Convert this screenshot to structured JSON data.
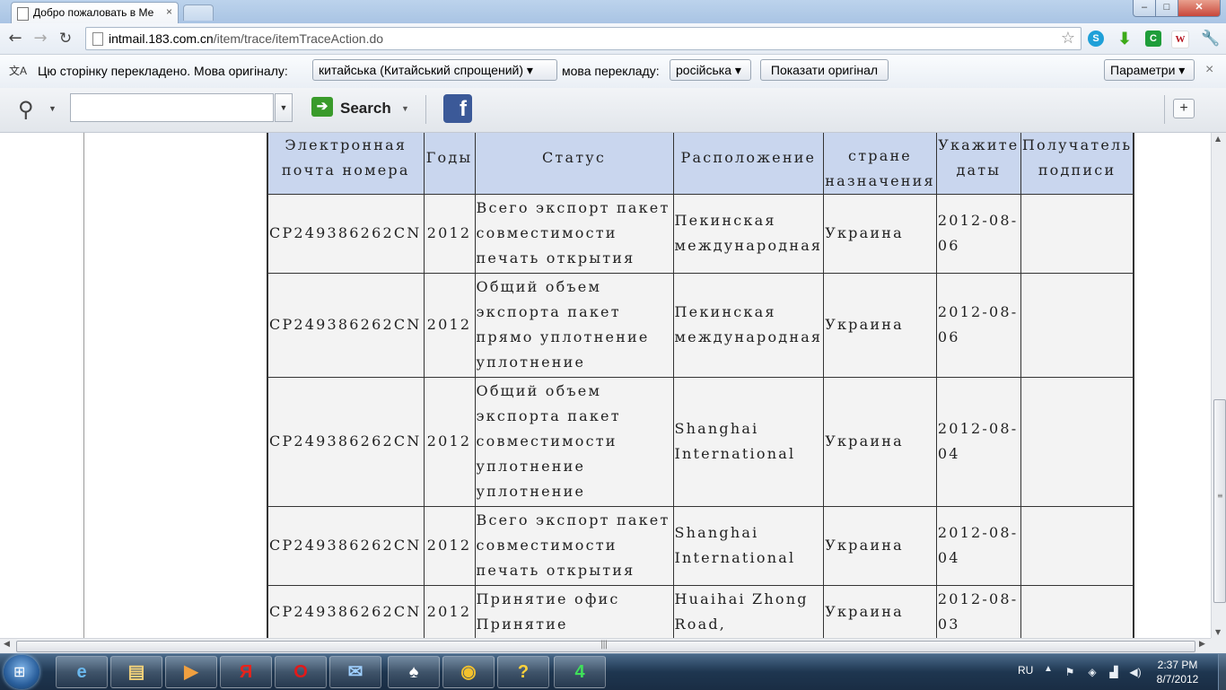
{
  "browser": {
    "tab_title": "Добро пожаловать в Ме",
    "tab_close": "×",
    "url_host": "intmail.183.com.cn",
    "url_path": "/item/trace/itemTraceAction.do",
    "window_buttons": {
      "minimize": "–",
      "maximize": "□",
      "close": "✕"
    }
  },
  "translate_bar": {
    "icon_label": "文A",
    "text_before": "Цю сторінку перекладено. Мова оригіналу:",
    "source_language": "китайська (Китайський спрощений) ▾",
    "text_middle": "мова перекладу:",
    "target_language": "російська ▾",
    "show_original_button": "Показати оригінал",
    "settings_button": "Параметри ▾",
    "close": "×"
  },
  "search_toolbar": {
    "search_label": "Search",
    "search_input_value": "",
    "facebook_label": "f",
    "add_button": "+"
  },
  "table": {
    "headers": [
      "Электронная почта номера",
      "Годы",
      "Статус",
      "Расположение",
      "стране назначения",
      "Укажите даты",
      "Получатель подписи"
    ],
    "rows": [
      {
        "number": "CP249386262CN",
        "year": "2012",
        "status": "Всего экспорт пакет совместимости печать открытия",
        "location": "Пекинская международная",
        "destination": "Украина",
        "date": "2012-08-06",
        "signature": ""
      },
      {
        "number": "CP249386262CN",
        "year": "2012",
        "status": "Общий объем экспорта пакет прямо уплотнение уплотнение",
        "location": "Пекинская международная",
        "destination": "Украина",
        "date": "2012-08-06",
        "signature": ""
      },
      {
        "number": "CP249386262CN",
        "year": "2012",
        "status": "Общий объем экспорта пакет совместимости уплотнение уплотнение",
        "location": "Shanghai International",
        "destination": "Украина",
        "date": "2012-08-04",
        "signature": ""
      },
      {
        "number": "CP249386262CN",
        "year": "2012",
        "status": "Всего экспорт пакет совместимости печать открытия",
        "location": "Shanghai International",
        "destination": "Украина",
        "date": "2012-08-04",
        "signature": ""
      },
      {
        "number": "CP249386262CN",
        "year": "2012",
        "status": "Принятие офис Принятие",
        "location": "Huaihai Zhong Road,",
        "destination": "Украина",
        "date": "2012-08-03",
        "signature": ""
      }
    ]
  },
  "taskbar": {
    "apps": [
      {
        "name": "ie",
        "glyph": "e",
        "color": "#6ab8ee"
      },
      {
        "name": "explorer",
        "glyph": "▤",
        "color": "#f3d27a"
      },
      {
        "name": "media",
        "glyph": "▶",
        "color": "#f0a040"
      },
      {
        "name": "yandex",
        "glyph": "Я",
        "color": "#e8231b"
      },
      {
        "name": "opera",
        "glyph": "O",
        "color": "#e01a1a"
      },
      {
        "name": "mail",
        "glyph": "✉",
        "color": "#9fd0ff"
      },
      {
        "name": "solitaire",
        "glyph": "♠",
        "color": "#ffffff"
      },
      {
        "name": "chrome",
        "glyph": "◉",
        "color": "#f2c12e"
      },
      {
        "name": "help",
        "glyph": "?",
        "color": "#ffd23a"
      },
      {
        "name": "gpu-monitor",
        "glyph": "4",
        "color": "#3fe05a"
      }
    ],
    "tray_language": "RU",
    "time": "2:37 PM",
    "date": "8/7/2012"
  }
}
